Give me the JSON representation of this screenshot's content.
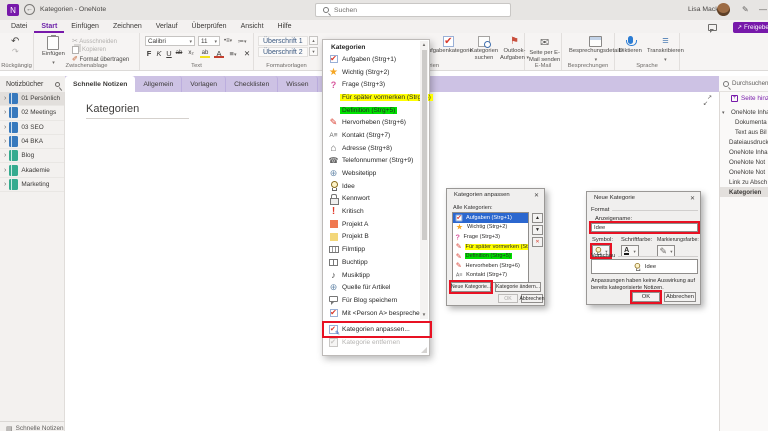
{
  "titlebar": {
    "title": "Kategorien - OneNote",
    "search_placeholder": "Suchen",
    "user_name": "Lisa Mack"
  },
  "menubar": {
    "items": [
      "Datei",
      "Start",
      "Einfügen",
      "Zeichnen",
      "Verlauf",
      "Überprüfen",
      "Ansicht",
      "Hilfe"
    ],
    "active_item": "Start",
    "share_label": "Freigeben"
  },
  "ribbon": {
    "undo_group": "Rückgängig",
    "clipboard_group": "Zwischenablage",
    "paste": "Einfügen",
    "cut": "Ausschneiden",
    "copy": "Kopieren",
    "format_painter": "Format übertragen",
    "text_group": "Text",
    "font_name": "Calibri",
    "font_size": "11",
    "styles_group": "Formatvorlagen",
    "heading1": "Überschrift 1",
    "heading2": "Überschrift 2",
    "tags_group": "Kategorien",
    "task_tag": "Aufgabenkategorie",
    "find_tags_line1": "Kategorien",
    "find_tags_line2": "suchen",
    "outlook_line1": "Outlook-",
    "outlook_line2": "Aufgaben",
    "email_group": "E-Mail",
    "email_line1": "Seite per E-",
    "email_line2": "Mail senden",
    "meetings_group": "Besprechungen",
    "meeting_details": "Besprechungsdetails",
    "speech_group": "Sprache",
    "dictate": "Diktieren",
    "transcribe": "Transkribieren"
  },
  "tabbar": {
    "notebooks_label": "Notizbücher",
    "tabs": [
      "Schnelle Notizen",
      "Allgemein",
      "Vorlagen",
      "Checklisten",
      "Wissen",
      "Archiv"
    ],
    "active_tab": "Schnelle Notizen"
  },
  "sidebar": {
    "notebooks": [
      {
        "name": "01 Persönlich",
        "color": "#3779bd",
        "selected": true
      },
      {
        "name": "02 Meetings",
        "color": "#3779bd"
      },
      {
        "name": "03 SEO",
        "color": "#3779bd"
      },
      {
        "name": "04 BKA",
        "color": "#3779bd"
      },
      {
        "name": "Blog",
        "color": "#35ab8f"
      },
      {
        "name": "Akademie",
        "color": "#35ab8f"
      },
      {
        "name": "Marketing",
        "color": "#35ab8f"
      }
    ],
    "footer": "Schnelle Notizen"
  },
  "content": {
    "page_title": "Kategorien"
  },
  "tag_dropdown": {
    "header": "Kategorien",
    "items": [
      {
        "label": "Aufgaben (Strg+1)",
        "icon": "check-icon"
      },
      {
        "label": "Wichtig (Strg+2)",
        "icon": "star-icon"
      },
      {
        "label": "Frage (Strg+3)",
        "icon": "question-icon"
      },
      {
        "label": "Für später vormerken (Strg+4)",
        "icon": "none",
        "highlight": "#ffff00"
      },
      {
        "label": "Definition (Strg+5)",
        "icon": "none",
        "highlight": "#00e000"
      },
      {
        "label": "Hervorheben (Strg+6)",
        "icon": "pen-icon"
      },
      {
        "label": "Kontakt (Strg+7)",
        "icon": "contact-icon"
      },
      {
        "label": "Adresse (Strg+8)",
        "icon": "home-icon"
      },
      {
        "label": "Telefonnummer (Strg+9)",
        "icon": "phone-icon"
      },
      {
        "label": "Websitetipp",
        "icon": "globe-icon"
      },
      {
        "label": "Idee",
        "icon": "lightbulb-icon"
      },
      {
        "label": "Kennwort",
        "icon": "lock-icon"
      },
      {
        "label": "Kritisch",
        "icon": "exclamation-icon"
      },
      {
        "label": "Projekt A",
        "icon": "red-square-icon"
      },
      {
        "label": "Projekt B",
        "icon": "yellow-square-icon"
      },
      {
        "label": "Filmtipp",
        "icon": "film-icon"
      },
      {
        "label": "Buchtipp",
        "icon": "book-icon"
      },
      {
        "label": "Musiktipp",
        "icon": "music-note-icon"
      },
      {
        "label": "Quelle für Artikel",
        "icon": "globe-icon"
      },
      {
        "label": "Für Blog speichern",
        "icon": "speech-bubble-icon"
      },
      {
        "label": "Mit <Person A> besprechen",
        "icon": "checkbox-check-icon"
      }
    ],
    "customize": "Kategorien anpassen...",
    "remove": "Kategorie entfernen"
  },
  "customize_dialog": {
    "title": "Kategorien anpassen",
    "list_label": "Alle Kategorien:",
    "items": [
      {
        "label": "Aufgaben (Strg+1)",
        "icon": "check-icon",
        "selected": true
      },
      {
        "label": "Wichtig (Strg+2)",
        "icon": "star-icon"
      },
      {
        "label": "Frage (Strg+3)",
        "icon": "question-icon"
      },
      {
        "label": "Für später vormerken (Strg+4)",
        "icon": "pen-icon",
        "highlight": "#ffff00"
      },
      {
        "label": "Definition (Strg+5)",
        "icon": "pen-icon",
        "highlight": "#00e000"
      },
      {
        "label": "Hervorheben (Strg+6)",
        "icon": "pen-icon"
      },
      {
        "label": "Kontakt (Strg+7)",
        "icon": "contact-icon"
      },
      {
        "label": "Adresse (Strg+8)",
        "icon": "home-icon"
      }
    ],
    "new_button": "Neue Kategorie...",
    "modify_button": "Kategorie ändern...",
    "ok": "OK",
    "cancel": "Abbrechen"
  },
  "new_tag_dialog": {
    "title": "Neue Kategorie",
    "format_section": "Format",
    "display_name_label": "Anzeigename:",
    "display_name_value": "Idee",
    "symbol_label": "Symbol:",
    "font_color_label": "Schriftfarbe:",
    "highlight_color_label": "Markierungsfarbe:",
    "preview_section": "Vorschau",
    "preview_text": "Idee",
    "note": "Anpassungen haben keine Auswirkung auf bereits kategorisierte Notizen.",
    "ok": "OK",
    "cancel": "Abbrechen"
  },
  "right_panel": {
    "search_placeholder": "Durchsuchen (Strg",
    "add_page": "Seite hinzufügen",
    "pages": [
      {
        "label": "OneNote Inha",
        "expandable": true
      },
      {
        "label": "Dokumenta",
        "indent": true
      },
      {
        "label": "Text aus Bil",
        "indent": true
      },
      {
        "label": "Dateiausdruck"
      },
      {
        "label": "OneNote Inha"
      },
      {
        "label": "OneNote Not"
      },
      {
        "label": "OneNote Not"
      },
      {
        "label": "Link zu Absch"
      },
      {
        "label": "Kategorien",
        "selected": true
      }
    ]
  },
  "colors": {
    "accent_purple": "#7719aa",
    "annotation_red": "#e81123",
    "selection_blue": "#2b67cf",
    "tag_yellow": "#ffff00",
    "tag_green": "#00e000"
  }
}
